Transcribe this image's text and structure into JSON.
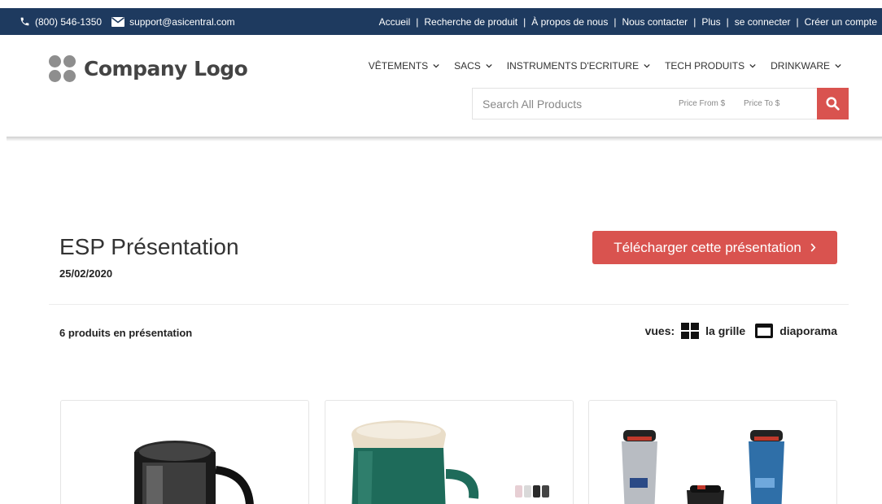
{
  "topbar": {
    "phone": "(800) 546-1350",
    "email": "support@asicentral.com",
    "links": [
      "Accueil",
      "Recherche de produit",
      "À propos de nous",
      "Nous contacter",
      "Plus",
      "se connecter",
      "Créer un compte"
    ],
    "separator": "|"
  },
  "header": {
    "logo_text": "Company Logo",
    "nav": [
      "VÊTEMENTS",
      "SACS",
      "INSTRUMENTS D'ECRITURE",
      "TECH PRODUITS",
      "DRINKWARE"
    ],
    "search": {
      "placeholder": "Search All Products",
      "price_from": "Price From $",
      "price_to": "Price To $"
    }
  },
  "presentation": {
    "title": "ESP Présentation",
    "date": "25/02/2020",
    "download_label": "Télécharger cette présentation",
    "count_text": "6 produits en présentation",
    "views_label": "vues:",
    "view_grid": "la grille",
    "view_slideshow": "diaporama"
  },
  "products": [
    {
      "image": "black-travel-mug"
    },
    {
      "image": "green-ceramic-mug"
    },
    {
      "image": "tumbler-set"
    }
  ],
  "colors": {
    "topbar_bg": "#1e3a5f",
    "accent": "#d9534f"
  }
}
